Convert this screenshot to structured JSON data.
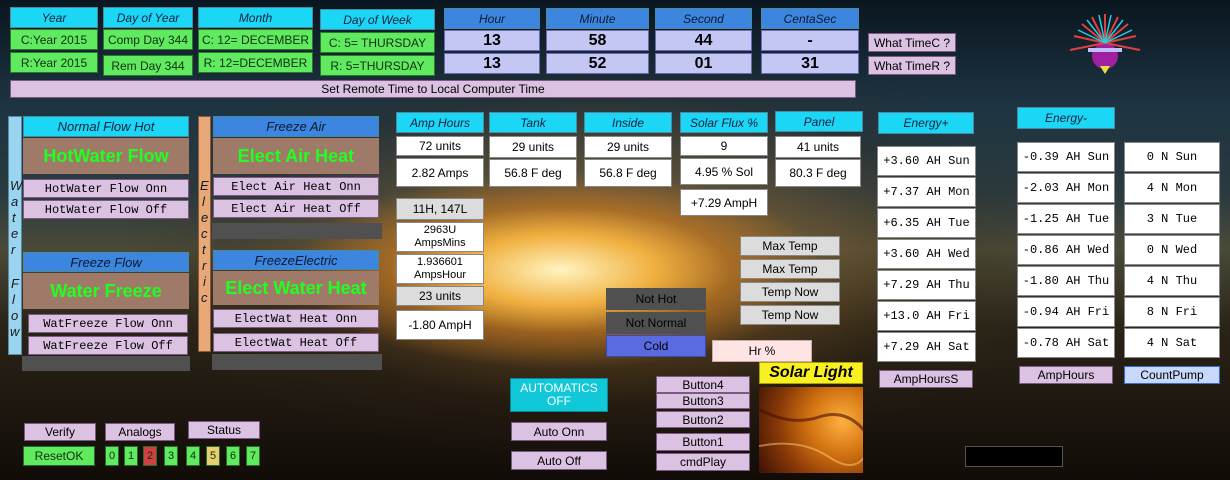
{
  "time": {
    "year": {
      "header": "Year",
      "c": "C:Year 2015",
      "r": "R:Year 2015"
    },
    "day_of_year": {
      "header": "Day of Year",
      "c": "Comp Day 344",
      "r": "Rem Day 344"
    },
    "month": {
      "header": "Month",
      "c": "C:  12= DECEMBER",
      "r": "R: 12=DECEMBER"
    },
    "day_of_week": {
      "header": "Day of Week",
      "c": "C:  5= THURSDAY",
      "r": "R:  5=THURSDAY"
    },
    "hour": {
      "header": "Hour",
      "c": "13",
      "r": "13"
    },
    "minute": {
      "header": "Minute",
      "c": "58",
      "r": "52"
    },
    "second": {
      "header": "Second",
      "c": "44",
      "r": "01"
    },
    "centasec": {
      "header": "CentaSec",
      "c": "-",
      "r": "31"
    },
    "what_time_c": "What TimeC ?",
    "what_time_r": "What TimeR ?",
    "set_remote": "Set Remote Time to Local Computer Time"
  },
  "water": {
    "side_letters": [
      "W",
      "a",
      "t",
      "e",
      "r",
      "F",
      "l",
      "o",
      "w"
    ],
    "normal_flow_hot": "Normal Flow Hot",
    "hotwater_flow": "HotWater Flow",
    "hotwater_onn": "HotWater Flow Onn",
    "hotwater_off": "HotWater Flow Off",
    "freeze_flow": "Freeze Flow",
    "water_freeze": "Water Freeze",
    "watfreeze_onn": "WatFreeze Flow Onn",
    "watfreeze_off": "WatFreeze Flow Off"
  },
  "electric": {
    "side_letters": [
      "E",
      "l",
      "e",
      "c",
      "t",
      "r",
      "i",
      "c"
    ],
    "freeze_air": "Freeze Air",
    "elect_air_heat": "Elect Air Heat",
    "elect_air_onn": "Elect Air Heat Onn",
    "elect_air_off": "Elect Air Heat Off",
    "freeze_electric": "FreezeElectric",
    "elect_water_heat": "Elect Water Heat",
    "electwat_onn": "ElectWat Heat Onn",
    "electwat_off": "ElectWat Heat Off"
  },
  "amp_hours": {
    "header": "Amp Hours",
    "units": "72 units",
    "amps": "2.82 Amps",
    "h_label": "11H, 147L",
    "amps_mins": "2963U\nAmpsMins",
    "amp_hour": "1.936601\nAmpsHour",
    "units2": "23 units",
    "amph": "-1.80 AmpH"
  },
  "tank": {
    "header": "Tank",
    "units": "29 units",
    "deg": "56.8 F deg"
  },
  "inside": {
    "header": "Inside",
    "units": "29 units",
    "deg": "56.8 F deg"
  },
  "solar_flux": {
    "header": "Solar Flux %",
    "value": "9",
    "sol": "4.95 % Sol",
    "amph": "+7.29 AmpH"
  },
  "panel": {
    "header": "Panel",
    "units": "41 units",
    "deg": "80.3 F deg"
  },
  "temps": [
    "Max Temp",
    "Max Temp",
    "Temp Now",
    "Temp Now"
  ],
  "status_boxes": {
    "not_hot": "Not Hot",
    "not_normal": "Not Normal",
    "cold": "Cold",
    "hr": "Hr  %"
  },
  "energy_plus": {
    "header": "Energy+",
    "rows": [
      "+3.60 AH Sun",
      "+7.37 AH Mon",
      "+6.35 AH Tue",
      "+3.60 AH Wed",
      "+7.29 AH Thu",
      "+13.0 AH Fri",
      "+7.29 AH Sat"
    ],
    "button": "AmpHoursS"
  },
  "energy_minus": {
    "header": "Energy-",
    "rows": [
      "-0.39 AH Sun",
      "-2.03 AH Mon",
      "-1.25 AH Tue",
      "-0.86 AH Wed",
      "-1.80 AH Thu",
      "-0.94 AH Fri",
      "-0.78 AH Sat"
    ],
    "button": "AmpHours"
  },
  "count_pump": {
    "rows": [
      "0 N Sun",
      "4 N Mon",
      "3 N Tue",
      "0 N Wed",
      "4 N Thu",
      "8 N Fri",
      "4 N Sat"
    ],
    "button": "CountPump"
  },
  "automatics": {
    "label": "AUTOMATICS\nOFF",
    "onn": "Auto Onn",
    "off": "Auto Off"
  },
  "buttons": {
    "b4": "Button4",
    "b3": "Button3",
    "b2": "Button2",
    "b1": "Button1",
    "cmd": "cmdPlay"
  },
  "solar_light": "Solar Light",
  "bottom": {
    "verify": "Verify",
    "analogs": "Analogs",
    "status": "Status",
    "reset": "ResetOK",
    "digits": [
      "0",
      "1",
      "2",
      "3",
      "4",
      "5",
      "6",
      "7"
    ],
    "digit_colors": [
      "#60ea60",
      "#60ea60",
      "#d04040",
      "#60ea60",
      "#60ea60",
      "#e8d070",
      "#60ea60",
      "#60ea60"
    ]
  }
}
